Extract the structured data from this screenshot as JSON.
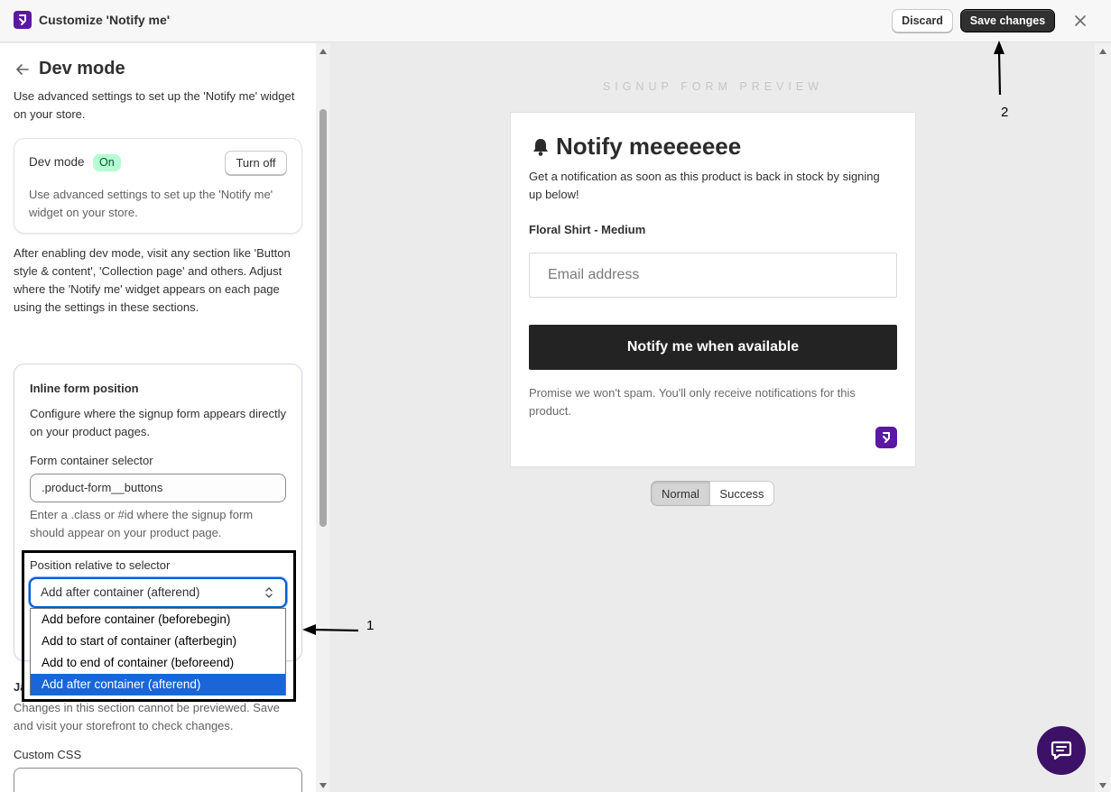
{
  "window": {
    "title": "Customize 'Notify me'"
  },
  "toolbar": {
    "discard_label": "Discard",
    "save_label": "Save changes"
  },
  "sidebar": {
    "heading": "Dev mode",
    "intro": "Use advanced settings to set up the 'Notify me' widget on your store.",
    "devmode_card": {
      "label": "Dev mode",
      "badge": "On",
      "turn_off_label": "Turn off",
      "description": "Use advanced settings to set up the 'Notify me' widget on your store."
    },
    "after_text": "After enabling dev mode, visit any section like 'Button style & content', 'Collection page' and others. Adjust where the 'Notify me' widget appears on each page using the settings in these sections.",
    "inline_card": {
      "title": "Inline form position",
      "description": "Configure where the signup form appears directly on your product pages.",
      "selector_label": "Form container selector",
      "selector_value": ".product-form__buttons",
      "selector_help": "Enter a .class or #id where the signup form should appear on your product page.",
      "position_label": "Position relative to selector",
      "position_value": "Add after container (afterend)",
      "position_options": [
        "Add before container (beforebegin)",
        "Add to start of container (afterbegin)",
        "Add to end of container (beforeend)",
        "Add after container (afterend)"
      ]
    },
    "js_label_partial": "Jav",
    "js_note": "Changes in this section cannot be previewed. Save and visit your storefront to check changes.",
    "custom_css_label": "Custom CSS"
  },
  "preview": {
    "label": "SIGNUP FORM PREVIEW",
    "form_title": "Notify meeeeeee",
    "description": "Get a notification as soon as this product is back in stock by signing up below!",
    "product": "Floral Shirt - Medium",
    "email_placeholder": "Email address",
    "submit_label": "Notify me when available",
    "spam_note": "Promise we won't spam. You'll only receive notifications for this product.",
    "tabs": [
      "Normal",
      "Success"
    ],
    "active_tab": "Normal"
  },
  "annotations": {
    "one": "1",
    "two": "2"
  },
  "colors": {
    "brand": "#5b18a3",
    "primary_button": "#303030",
    "select_focus": "#005bd3",
    "badge_on": "#b4fed2"
  }
}
